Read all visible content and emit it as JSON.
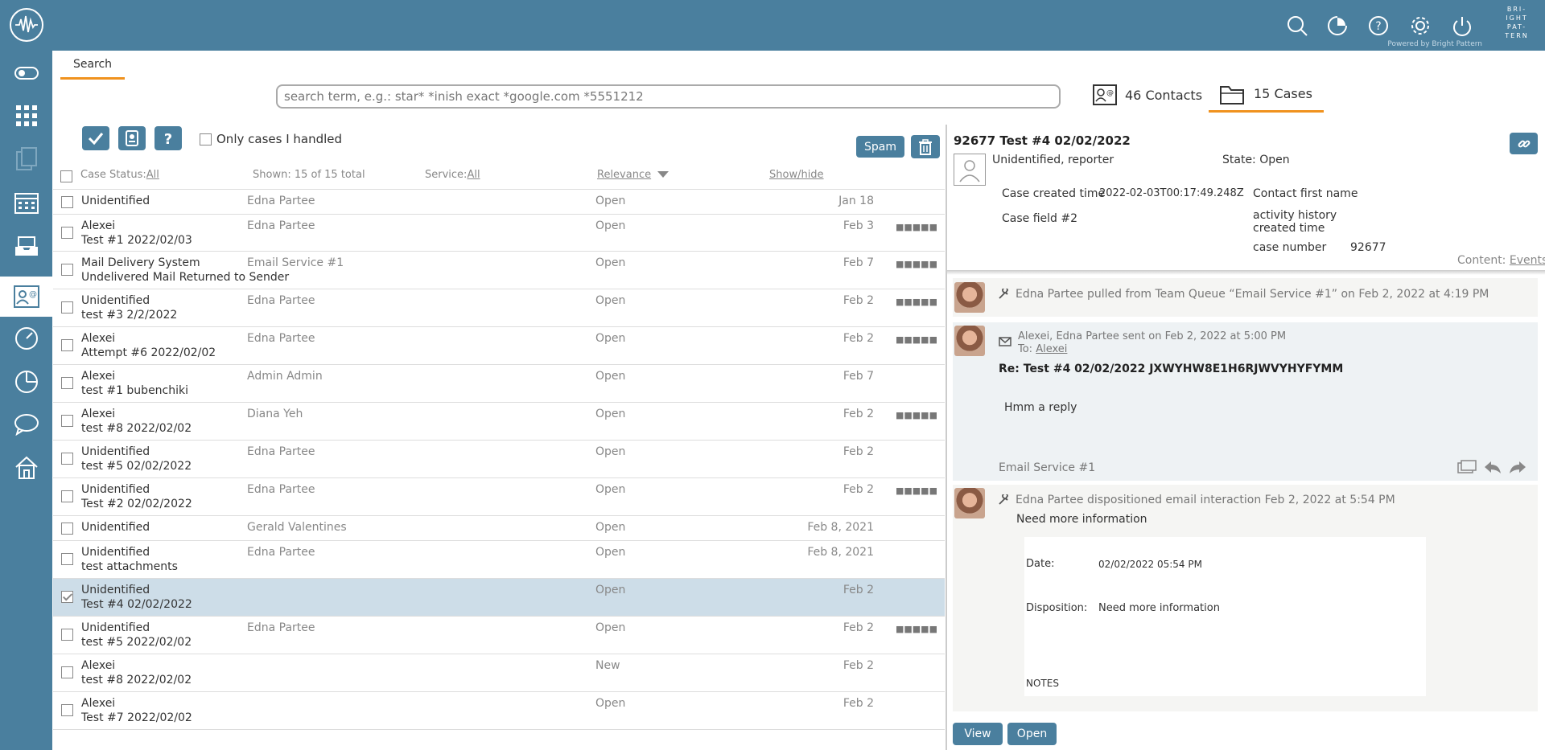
{
  "brand": {
    "line1": "BRI-",
    "line2": "IGHT",
    "line3": "PAT-",
    "line4": "TERN",
    "powered": "Powered by Bright Pattern"
  },
  "topbar_icons": [
    "search-icon",
    "activity-icon",
    "help-icon",
    "settings-icon",
    "power-icon"
  ],
  "sidebar_icons": [
    "toggle-icon",
    "apps-grid-icon",
    "documents-icon",
    "calendar-icon",
    "inbox-icon",
    "contacts-icon",
    "dashboard-icon",
    "reports-icon",
    "chat-icon",
    "home-icon"
  ],
  "tab": {
    "label": "Search"
  },
  "search": {
    "placeholder": "search term, e.g.: star* *inish exact *google.com *5551212"
  },
  "categories": {
    "contacts": "46 Contacts",
    "cases": "15 Cases"
  },
  "toolbar": {
    "only_handled": "Only cases I handled",
    "spam": "Spam"
  },
  "list_header": {
    "case_status": "Case Status:",
    "case_status_val": "All",
    "shown": "Shown: 15 of 15 total",
    "service": "Service:",
    "service_val": "All",
    "relevance": "Relevance",
    "show_hide": "Show/hide"
  },
  "rows": [
    {
      "t1": "Unidentified",
      "t2": "",
      "owner": "Edna Partee",
      "status": "Open",
      "date": "Jan 18",
      "priority": "",
      "checked": false
    },
    {
      "t1": "Alexei",
      "t2": "Test #1 2022/02/03",
      "owner": "Edna Partee",
      "status": "Open",
      "date": "Feb 3",
      "priority": "■■■■■",
      "checked": false
    },
    {
      "t1": "Mail Delivery System",
      "t2": "Undelivered Mail Returned to Sender",
      "owner": "Email Service #1",
      "status": "Open",
      "date": "Feb 7",
      "priority": "■■■■■",
      "checked": false
    },
    {
      "t1": "Unidentified",
      "t2": "test #3 2/2/2022",
      "owner": "Edna Partee",
      "status": "Open",
      "date": "Feb 2",
      "priority": "■■■■■",
      "checked": false
    },
    {
      "t1": "Alexei",
      "t2": "Attempt #6 2022/02/02",
      "owner": "Edna Partee",
      "status": "Open",
      "date": "Feb 2",
      "priority": "■■■■■",
      "checked": false
    },
    {
      "t1": "Alexei",
      "t2": "test #1 bubenchiki",
      "owner": "Admin Admin",
      "status": "Open",
      "date": "Feb 7",
      "priority": "",
      "checked": false
    },
    {
      "t1": "Alexei",
      "t2": "test #8 2022/02/02",
      "owner": "Diana Yeh",
      "status": "Open",
      "date": "Feb 2",
      "priority": "■■■■■",
      "checked": false
    },
    {
      "t1": "Unidentified",
      "t2": "test #5 02/02/2022",
      "owner": "Edna Partee",
      "status": "Open",
      "date": "Feb 2",
      "priority": "",
      "checked": false
    },
    {
      "t1": "Unidentified",
      "t2": "Test #2 02/02/2022",
      "owner": "Edna Partee",
      "status": "Open",
      "date": "Feb 2",
      "priority": "■■■■■",
      "checked": false
    },
    {
      "t1": "Unidentified",
      "t2": "",
      "owner": "Gerald Valentines",
      "status": "Open",
      "date": "Feb 8, 2021",
      "priority": "",
      "checked": false
    },
    {
      "t1": "Unidentified",
      "t2": "test attachments",
      "owner": "Edna Partee",
      "status": "Open",
      "date": "Feb 8, 2021",
      "priority": "",
      "checked": false
    },
    {
      "t1": "Unidentified",
      "t2": "Test #4 02/02/2022",
      "owner": "",
      "status": "Open",
      "date": "Feb 2",
      "priority": "",
      "checked": true
    },
    {
      "t1": "Unidentified",
      "t2": "test #5 2022/02/02",
      "owner": "Edna Partee",
      "status": "Open",
      "date": "Feb 2",
      "priority": "■■■■■",
      "checked": false
    },
    {
      "t1": "Alexei",
      "t2": "test #8 2022/02/02",
      "owner": "",
      "status": "New",
      "date": "Feb 2",
      "priority": "",
      "checked": false
    },
    {
      "t1": "Alexei",
      "t2": "Test #7 2022/02/02",
      "owner": "",
      "status": "Open",
      "date": "Feb 2",
      "priority": "",
      "checked": false
    }
  ],
  "case": {
    "title": "92677  Test #4 02/02/2022",
    "reporter": "Unidentified, reporter",
    "state_label": "State: Open",
    "created_label": "Case created time",
    "created_val": "2022-02-03T00:17:49.248Z",
    "field2_label": "Case field #2",
    "contact_first": "Contact first name",
    "activity_label_1": "activity history",
    "activity_label_2": "created time",
    "case_number_label": "case number",
    "case_number_val": "92677",
    "content_label": "Content:",
    "content_link": "Events"
  },
  "activity": {
    "a1": "Edna Partee pulled from Team Queue “Email Service #1” on Feb 2, 2022 at 4:19 PM",
    "a2_header": "Alexei, Edna Partee sent on Feb 2, 2022 at 5:00 PM",
    "a2_to": "To:",
    "a2_to_name": "Alexei",
    "a2_subject": "Re: Test #4 02/02/2022 JXWYHW8E1H6RJWVYHYFYMM",
    "a2_body": "Hmm a reply",
    "a2_service": "Email Service #1",
    "a3": "Edna Partee dispositioned email interaction Feb 2, 2022 at 5:54 PM",
    "a3_disposition": "Need more information",
    "date_label": "Date:",
    "date_val": "02/02/2022 05:54 PM",
    "disp_label": "Disposition:",
    "disp_val": "Need more information",
    "notes": "NOTES"
  },
  "buttons": {
    "view": "View",
    "open": "Open"
  }
}
